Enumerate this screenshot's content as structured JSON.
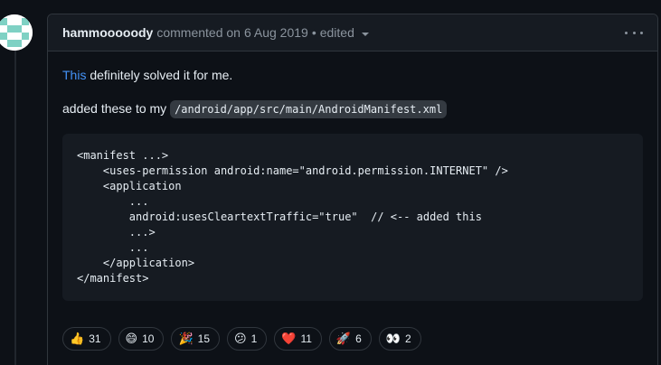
{
  "comment": {
    "author": "hammooooody",
    "action": "commented on",
    "date": "6 Aug 2019",
    "separator": "•",
    "edited_label": "edited"
  },
  "body": {
    "link_text": "This",
    "line1_rest": " definitely solved it for me.",
    "line2_prefix": "added these to my ",
    "inline_code": "/android/app/src/main/AndroidManifest.xml",
    "code_block": "<manifest ...>\n    <uses-permission android:name=\"android.permission.INTERNET\" />\n    <application\n        ...\n        android:usesCleartextTraffic=\"true\"  // <-- added this\n        ...>\n        ...\n    </application>\n</manifest>"
  },
  "reactions": [
    {
      "name": "thumbs-up",
      "emoji": "👍",
      "count": "31"
    },
    {
      "name": "laugh",
      "emoji": "😄",
      "count": "10"
    },
    {
      "name": "hooray",
      "emoji": "🎉",
      "count": "15"
    },
    {
      "name": "confused",
      "emoji": "😕",
      "count": "1"
    },
    {
      "name": "heart",
      "emoji": "❤️",
      "count": "11"
    },
    {
      "name": "rocket",
      "emoji": "🚀",
      "count": "6"
    },
    {
      "name": "eyes",
      "emoji": "👀",
      "count": "2"
    }
  ],
  "colors": {
    "background": "#0d1117",
    "header": "#161b22",
    "border": "#30363d",
    "link": "#4493f8",
    "muted": "#8b949e",
    "avatar": "#7fd1c4"
  },
  "icons": {
    "avatar": "identicon-avatar",
    "caret": "caret-down-icon",
    "more": "kebab-horizontal-icon"
  }
}
